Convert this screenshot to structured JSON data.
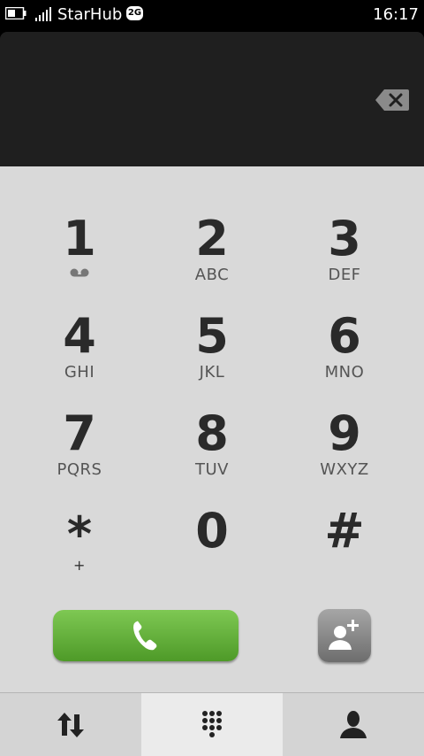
{
  "status_bar": {
    "carrier": "StarHub",
    "network": "2G",
    "time": "16:17",
    "icons": [
      "battery-icon",
      "signal-strength-icon"
    ]
  },
  "display": {
    "number": "",
    "backspace_icon": "backspace-icon"
  },
  "keypad": {
    "keys": [
      {
        "digit": "1",
        "letters": "",
        "icon": "voicemail-icon"
      },
      {
        "digit": "2",
        "letters": "ABC"
      },
      {
        "digit": "3",
        "letters": "DEF"
      },
      {
        "digit": "4",
        "letters": "GHI"
      },
      {
        "digit": "5",
        "letters": "JKL"
      },
      {
        "digit": "6",
        "letters": "MNO"
      },
      {
        "digit": "7",
        "letters": "PQRS"
      },
      {
        "digit": "8",
        "letters": "TUV"
      },
      {
        "digit": "9",
        "letters": "WXYZ"
      },
      {
        "digit": "*",
        "letters": "+"
      },
      {
        "digit": "0",
        "letters": ""
      },
      {
        "digit": "#",
        "letters": ""
      }
    ]
  },
  "actions": {
    "call_icon": "phone-handset-icon",
    "add_contact_icon": "add-contact-icon"
  },
  "bottom_nav": {
    "tabs": [
      {
        "icon": "call-log-arrows-icon",
        "active": false
      },
      {
        "icon": "dialpad-icon",
        "active": true
      },
      {
        "icon": "contacts-person-icon",
        "active": false
      }
    ]
  },
  "colors": {
    "call_green": "#5fae35",
    "display_bg": "#1f1f1f",
    "keypad_bg": "#d9d9d9"
  }
}
